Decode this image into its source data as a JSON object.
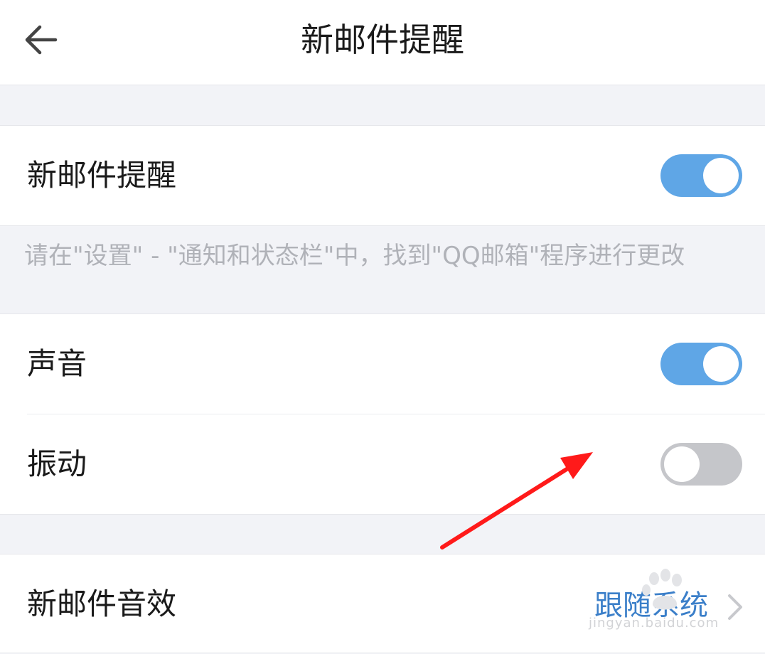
{
  "header": {
    "back_icon": "arrow-left-icon",
    "title": "新邮件提醒"
  },
  "notification_toggle": {
    "label": "新邮件提醒",
    "on": true
  },
  "hint_text": "请在\"设置\" - \"通知和状态栏\"中，找到\"QQ邮箱\"程序进行更改",
  "settings": {
    "sound": {
      "label": "声音",
      "on": true
    },
    "vibrate": {
      "label": "振动",
      "on": false
    }
  },
  "sound_effect": {
    "label": "新邮件音效",
    "value": "跟随系统",
    "chevron_icon": "chevron-right-icon"
  },
  "watermark": {
    "text": "jingyan.baidu.com"
  },
  "colors": {
    "toggle_on": "#5fa6e6",
    "toggle_off": "#c5c6ca",
    "link": "#3b7fc9",
    "annotation_arrow": "#ff1a1a",
    "background": "#f2f3f7"
  }
}
